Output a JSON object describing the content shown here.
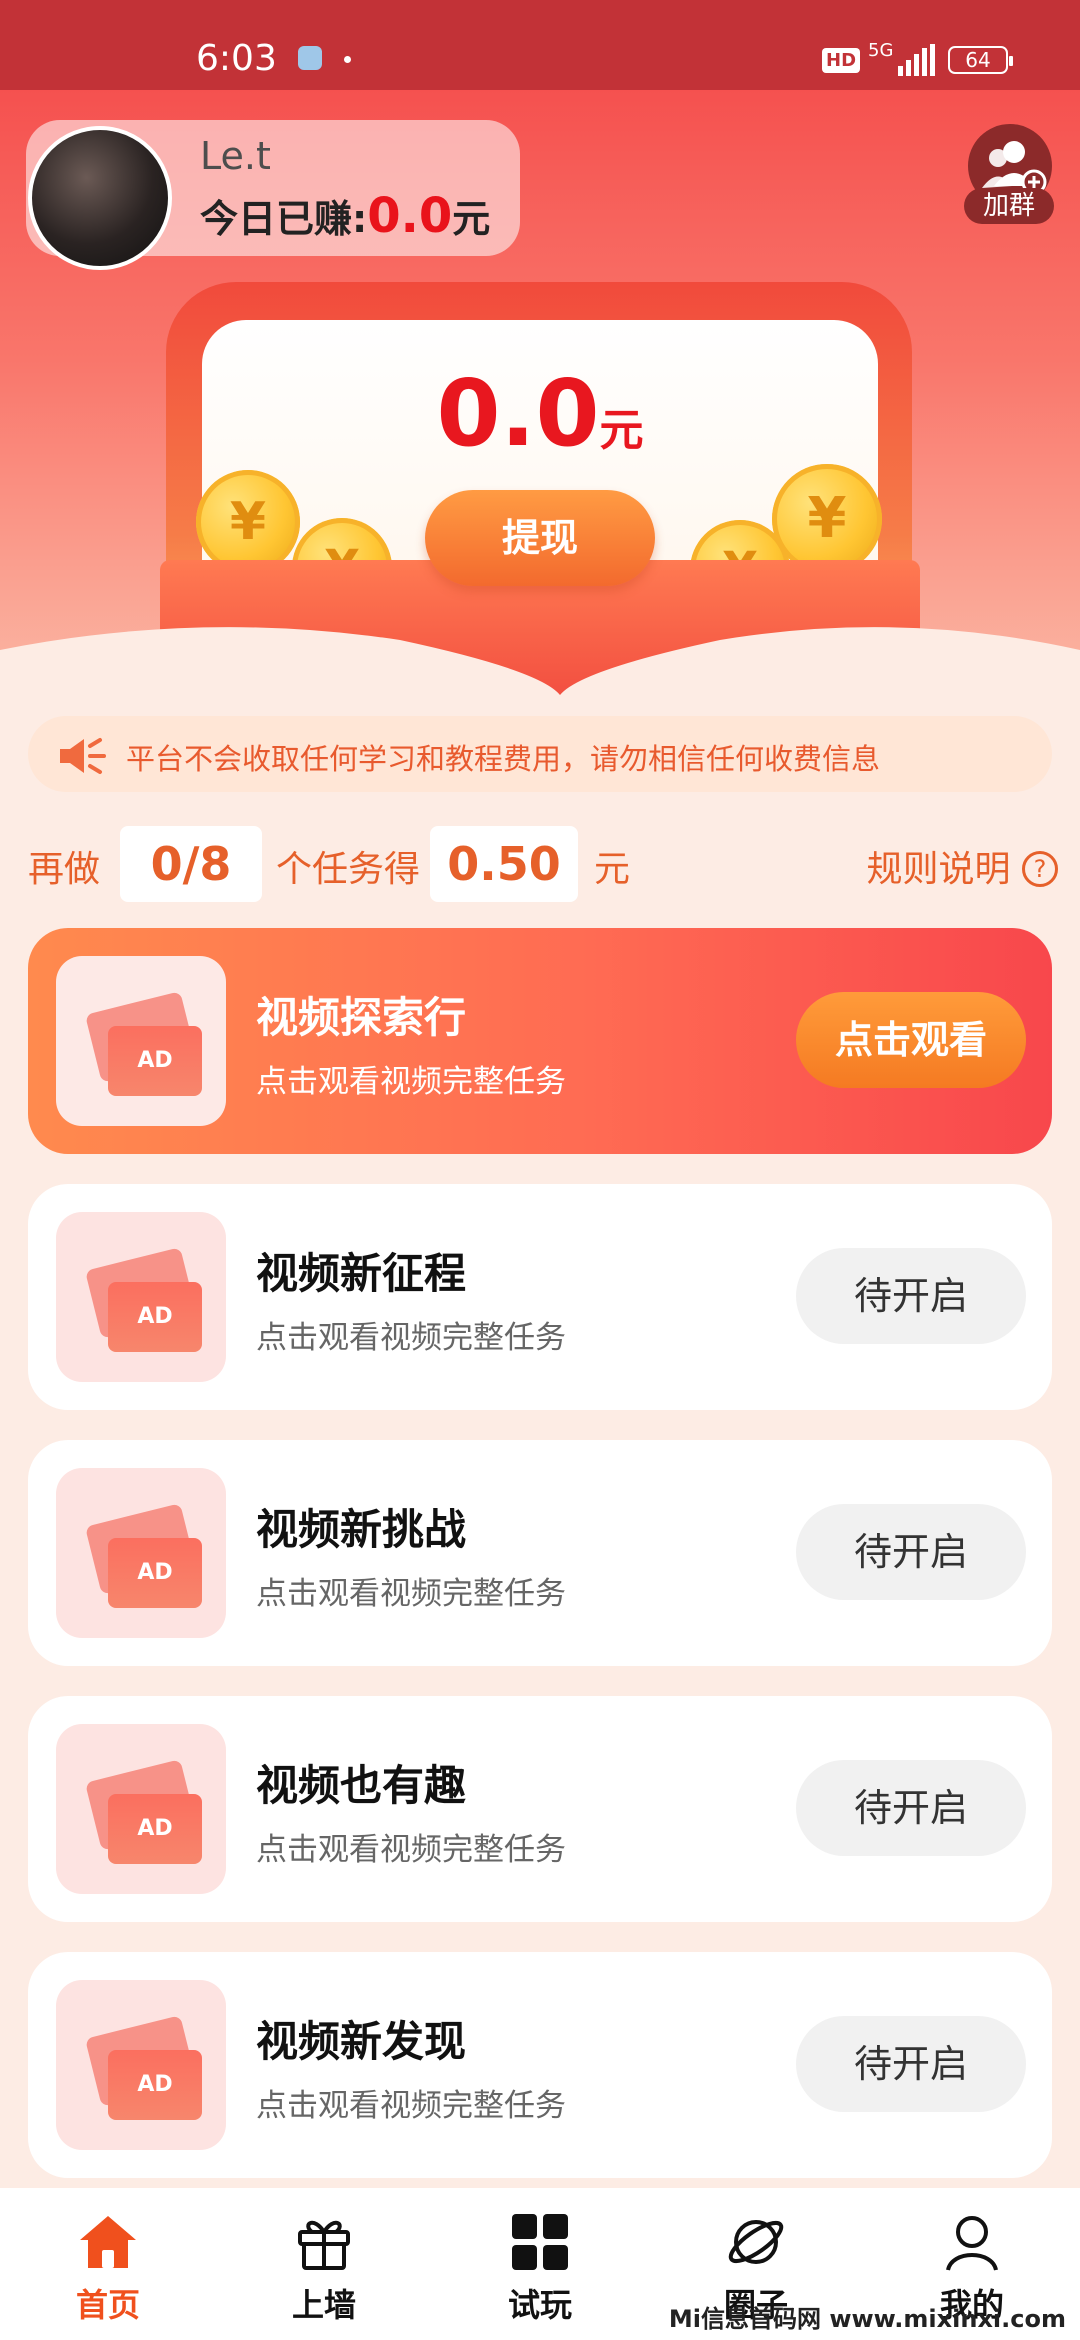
{
  "status_bar": {
    "time": "6:03",
    "hd": "HD",
    "network": "5G",
    "battery": "64"
  },
  "profile": {
    "username": "Le.t",
    "earned_label": "今日已赚:",
    "earned_amount": "0.0",
    "earned_unit": "元"
  },
  "join_group": {
    "label": "加群"
  },
  "wallet": {
    "balance": "0.0",
    "unit": "元",
    "withdraw_label": "提现",
    "coin_symbol": "¥"
  },
  "notice": {
    "icon": "megaphone-icon",
    "text": "平台不会收取任何学习和教程费用，请勿相信任何收费信息"
  },
  "progress": {
    "prefix": "再做",
    "done": "0/8",
    "middle": "个任务得",
    "reward": "0.50",
    "unit": "元",
    "rules_label": "规则说明",
    "help_symbol": "?"
  },
  "tasks": [
    {
      "title": "视频探索行",
      "subtitle": "点击观看视频完整任务",
      "button": "点击观看",
      "badge": "AD",
      "active": true
    },
    {
      "title": "视频新征程",
      "subtitle": "点击观看视频完整任务",
      "button": "待开启",
      "badge": "AD",
      "active": false
    },
    {
      "title": "视频新挑战",
      "subtitle": "点击观看视频完整任务",
      "button": "待开启",
      "badge": "AD",
      "active": false
    },
    {
      "title": "视频也有趣",
      "subtitle": "点击观看视频完整任务",
      "button": "待开启",
      "badge": "AD",
      "active": false
    },
    {
      "title": "视频新发现",
      "subtitle": "点击观看视频完整任务",
      "button": "待开启",
      "badge": "AD",
      "active": false
    }
  ],
  "tab_bar": [
    {
      "label": "首页",
      "icon": "home-icon",
      "active": true
    },
    {
      "label": "上墙",
      "icon": "gift-icon",
      "active": false
    },
    {
      "label": "试玩",
      "icon": "grid-icon",
      "active": false
    },
    {
      "label": "圈子",
      "icon": "planet-icon",
      "active": false
    },
    {
      "label": "我的",
      "icon": "user-icon",
      "active": false
    }
  ],
  "watermark": "Mi信息首码网 www.mixinxi.com",
  "colors": {
    "brand_red": "#e8171f",
    "accent_orange": "#f0501d",
    "status_bar": "#c23237"
  }
}
